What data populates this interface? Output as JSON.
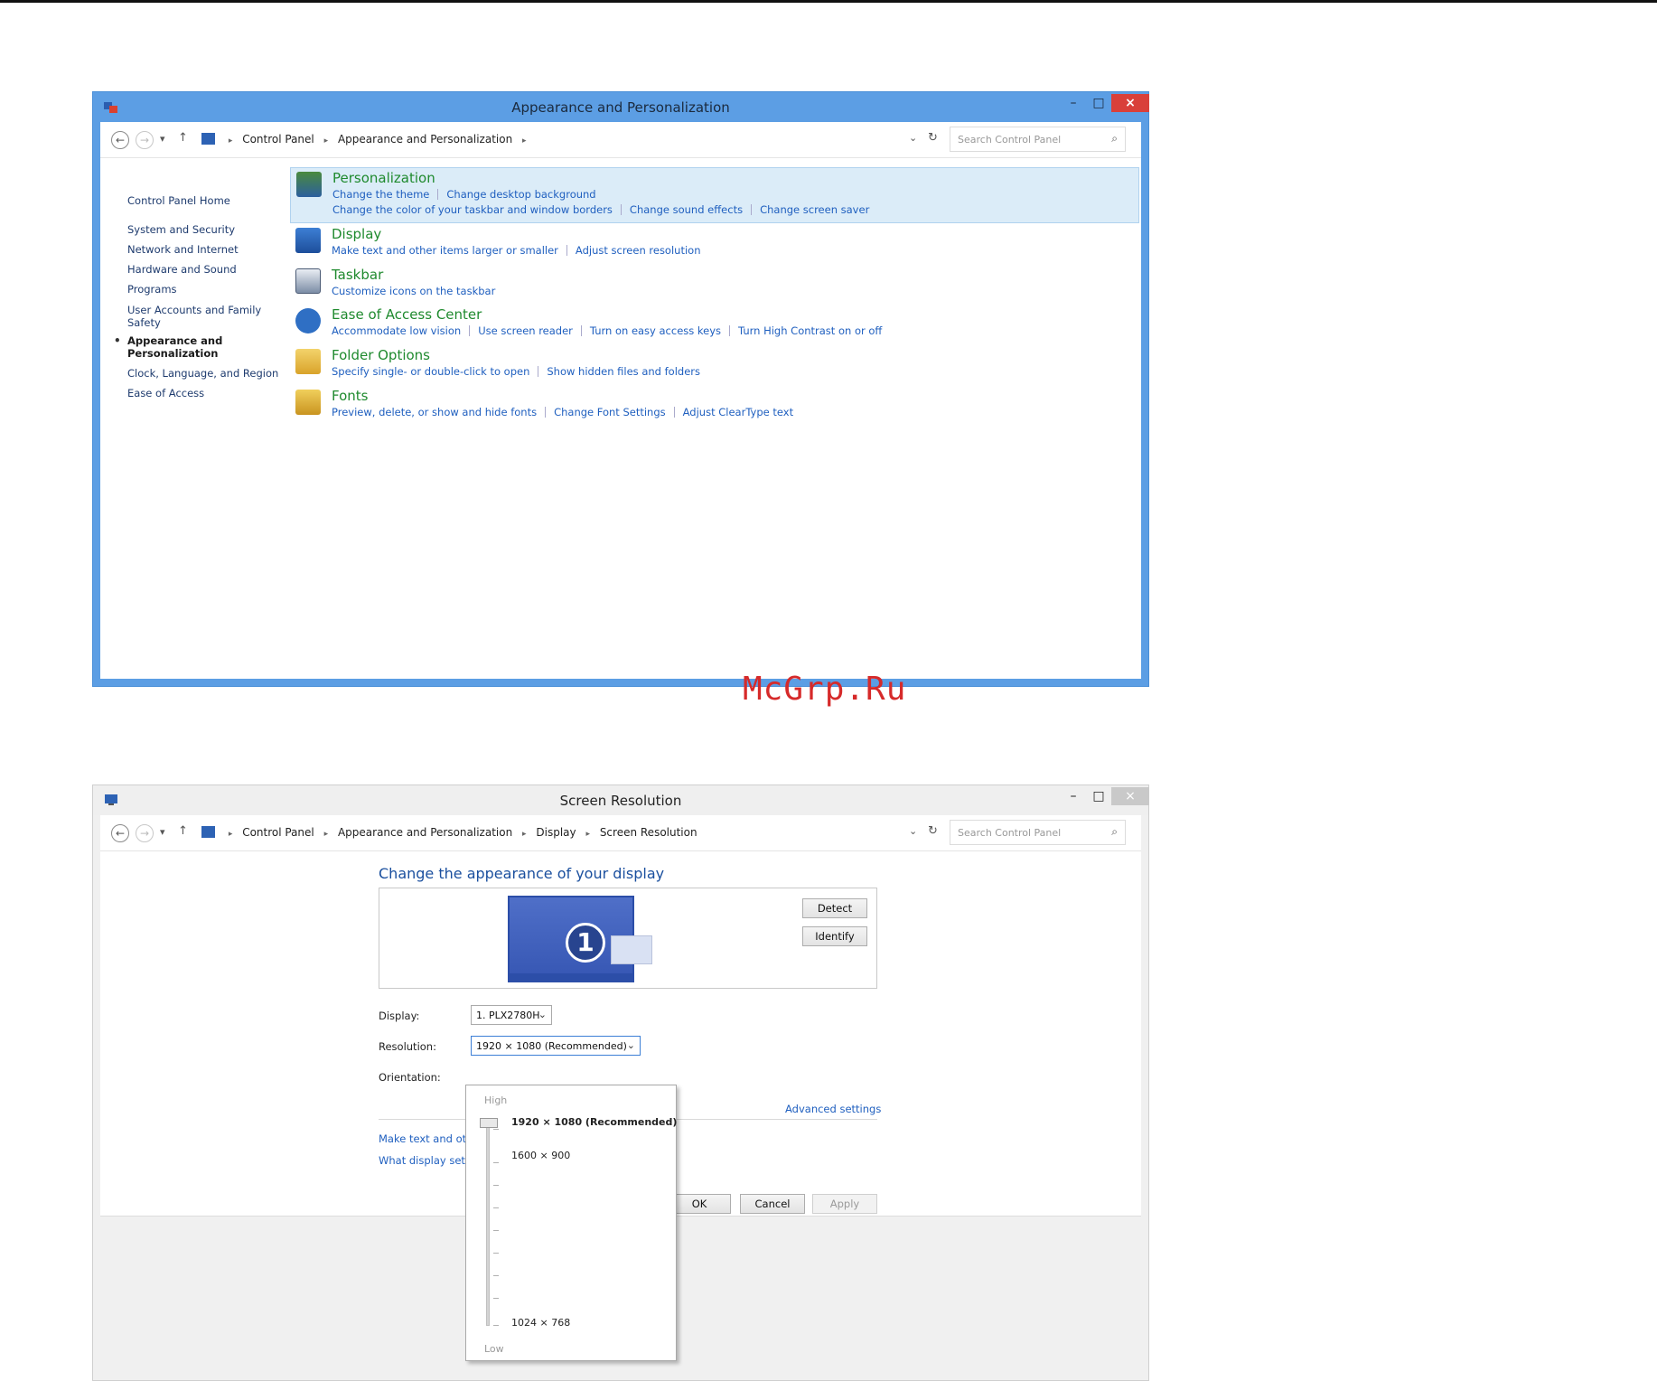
{
  "watermark": "McGrp.Ru",
  "window1": {
    "title": "Appearance and Personalization",
    "breadcrumb": [
      "Control Panel",
      "Appearance and Personalization"
    ],
    "search_placeholder": "Search Control Panel",
    "sidebar": {
      "home": "Control Panel Home",
      "items": [
        "System and Security",
        "Network and Internet",
        "Hardware and Sound",
        "Programs",
        "User Accounts and Family",
        "Safety",
        "Appearance and",
        "Personalization",
        "Clock, Language, and Region",
        "Ease of Access"
      ]
    },
    "categories": [
      {
        "name": "Personalization",
        "icon": "personalization-icon",
        "links": [
          "Change the theme",
          "Change desktop background"
        ],
        "links2": [
          "Change the color of your taskbar and window borders",
          "Change sound effects",
          "Change screen saver"
        ]
      },
      {
        "name": "Display",
        "icon": "display-icon",
        "links": [
          "Make text and other items larger or smaller",
          "Adjust screen resolution"
        ]
      },
      {
        "name": "Taskbar",
        "icon": "taskbar-icon",
        "links": [
          "Customize icons on the taskbar"
        ]
      },
      {
        "name": "Ease of Access Center",
        "icon": "ease-of-access-icon",
        "links": [
          "Accommodate low vision",
          "Use screen reader",
          "Turn on easy access keys",
          "Turn High Contrast on or off"
        ]
      },
      {
        "name": "Folder Options",
        "icon": "folder-options-icon",
        "links": [
          "Specify single- or double-click to open",
          "Show hidden files and folders"
        ]
      },
      {
        "name": "Fonts",
        "icon": "fonts-icon",
        "links": [
          "Preview, delete, or show and hide fonts",
          "Change Font Settings",
          "Adjust ClearType text"
        ]
      }
    ]
  },
  "window2": {
    "title": "Screen Resolution",
    "breadcrumb": [
      "Control Panel",
      "Appearance and Personalization",
      "Display",
      "Screen Resolution"
    ],
    "search_placeholder": "Search Control Panel",
    "heading": "Change the appearance of your display",
    "monitor_number": "1",
    "detect": "Detect",
    "identify": "Identify",
    "display_label": "Display:",
    "display_value": "1. PLX2780H",
    "resolution_label": "Resolution:",
    "resolution_value": "1920 × 1080 (Recommended)",
    "orientation_label": "Orientation:",
    "advanced": "Advanced settings",
    "link_text_size": "Make text and other",
    "link_what_display": "What display setting",
    "ok": "OK",
    "cancel": "Cancel",
    "apply": "Apply",
    "dropdown": {
      "high": "High",
      "low": "Low",
      "options": [
        "1920 × 1080 (Recommended)",
        "1600 × 900",
        "1024 × 768"
      ],
      "selected_index": 0
    }
  }
}
